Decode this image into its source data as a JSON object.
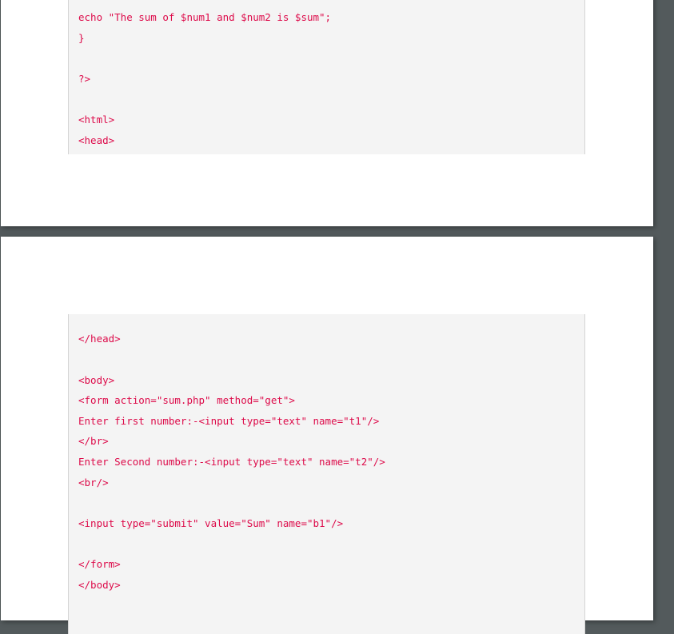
{
  "pages": [
    {
      "code_lines": [
        "echo \"The sum of $num1 and $num2 is $sum\";",
        "}",
        "?>",
        "<html>",
        "<head>"
      ]
    },
    {
      "code_lines": [
        "</head>",
        "<body>",
        "<form action=\"sum.php\" method=\"get\">",
        "Enter first number:-<input type=\"text\" name=\"t1\"/>",
        "</br>",
        "Enter Second number:-<input type=\"text\" name=\"t2\"/>",
        "<br/>",
        "<input type=\"submit\" value=\"Sum\" name=\"b1\"/>",
        "</form>",
        "</body>"
      ]
    }
  ],
  "colors": {
    "code_text": "#dd0b4a",
    "code_bg": "#f4f4f4",
    "viewer_bg": "#535a5c"
  }
}
